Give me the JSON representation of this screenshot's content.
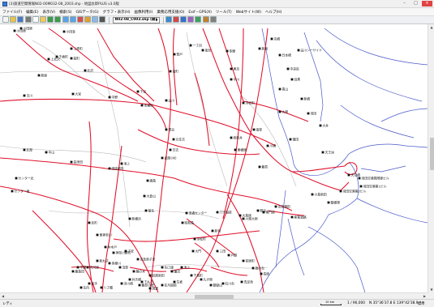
{
  "window": {
    "title": "(3)鉄道空間情報N02-00M032-08_2003.shp - 地図太郎PLUS v3.0版",
    "controls": [
      "–",
      "□",
      "×"
    ]
  },
  "menu": {
    "items": [
      "ファイル(F)",
      "編集(E)",
      "表示(V)",
      "検索(S)",
      "GISデータ(G)",
      "グラフ・表示(H)",
      "画像利用(I)",
      "業務応用支援(O)",
      "Exif・GPS(X)",
      "ツール(T)",
      "Webサイト(W)",
      "ヘルプ(H)"
    ]
  },
  "toolbar": {
    "layer_combo_value": "N02-08_C003.shp (線)",
    "buttons": [
      {
        "name": "new-icon",
        "color": "#f5f5f5"
      },
      {
        "name": "open-icon",
        "color": "#e8c34a"
      },
      {
        "name": "save-icon",
        "color": "#4a78c6"
      },
      {
        "name": "print-icon",
        "color": "#7a7a7a"
      },
      {
        "name": "select-icon",
        "color": "#ffffff"
      },
      {
        "name": "pan-icon",
        "color": "#f2c95a"
      },
      {
        "name": "zoom-in-icon",
        "color": "#3f9a4a"
      },
      {
        "name": "zoom-out-icon",
        "color": "#3f9a4a"
      },
      {
        "name": "full-extent-icon",
        "color": "#5aa3e8"
      },
      {
        "name": "grid-icon",
        "color": "#5aa3e8"
      },
      {
        "name": "measure-icon",
        "color": "#d45050"
      },
      {
        "name": "layer-icon",
        "color": "#e0a030"
      },
      {
        "name": "table-icon",
        "color": "#8bb8e8"
      },
      {
        "name": "camera-icon",
        "color": "#555555"
      }
    ],
    "right_buttons": [
      {
        "name": "globe-icon",
        "color": "#3a8ad0"
      },
      {
        "name": "gps-icon",
        "color": "#d24a4a"
      },
      {
        "name": "info-icon",
        "color": "#3a6ed0"
      },
      {
        "name": "pen-icon",
        "color": "#a060c0"
      },
      {
        "name": "color-icon",
        "color": "#40a060"
      },
      {
        "name": "ruler-icon",
        "color": "#c08030"
      },
      {
        "name": "settings-icon",
        "color": "#808080"
      }
    ]
  },
  "map": {
    "background": "#ffffff",
    "railway_color": "#e0102a",
    "coast_color": "#4a58c8",
    "road_color": "#b8b8b8",
    "station_color": "#111111",
    "labels": [
      "小田原",
      "小田急",
      "上柿町",
      "上北沢",
      "千歳町",
      "萩町",
      "小田原",
      "新座",
      "北沢",
      "玉川",
      "大宮",
      "中野",
      "永福町",
      "品川",
      "下谷",
      "南町",
      "登戸",
      "一丁目",
      "南台",
      "多摩",
      "東京",
      "中川",
      "浜松町",
      "新宿",
      "京橋",
      "日本橋",
      "中央区",
      "目黒",
      "青山",
      "大崎",
      "新橋",
      "品川シーサイド",
      "羽田",
      "大井",
      "蒲田",
      "川崎",
      "鶴見",
      "西新井",
      "東横線",
      "南部",
      "北部",
      "センター北",
      "センター南",
      "中山",
      "長津田",
      "田園都市",
      "池上",
      "雪谷",
      "武蔵小杉",
      "元住吉",
      "日吉",
      "綱島",
      "大倉山",
      "菊名",
      "新横浜",
      "新羽",
      "川崎大師",
      "東門前",
      "産業道路",
      "小島新田",
      "天空橋",
      "羽田空港国際線ビル",
      "羽田空港第1ビル",
      "羽田空港第2ビル",
      "整備場",
      "天王洲",
      "京急蒲田",
      "糀谷",
      "大鳥居",
      "穴守稲荷",
      "流通センター",
      "昭和島",
      "浜松町",
      "大門",
      "三田",
      "戸越",
      "荏原町",
      "旗の台",
      "長原",
      "洗足池",
      "石川台",
      "御嶽山",
      "久が原",
      "千鳥町",
      "池上",
      "蓮沼",
      "矢口渡",
      "武蔵新田",
      "下丸子",
      "鵜の木",
      "沼部",
      "多摩川",
      "新丸子",
      "向河原",
      "平間",
      "鹿島田",
      "矢向",
      "尻手",
      "八丁畷",
      "浜川崎",
      "弁天橋",
      "鶴見小野",
      "国道",
      "花月園前",
      "生麦",
      "京急新子安",
      "子安",
      "神奈川新町",
      "仲木戸",
      "東神奈川",
      "反町",
      "横浜"
    ]
  },
  "status": {
    "left": "レディ",
    "scale_label": "10 km",
    "scale_text": "1 / 96,000",
    "coordinates": "N 35°36'37.8  E 139°42'38.9",
    "mode": "標準"
  }
}
